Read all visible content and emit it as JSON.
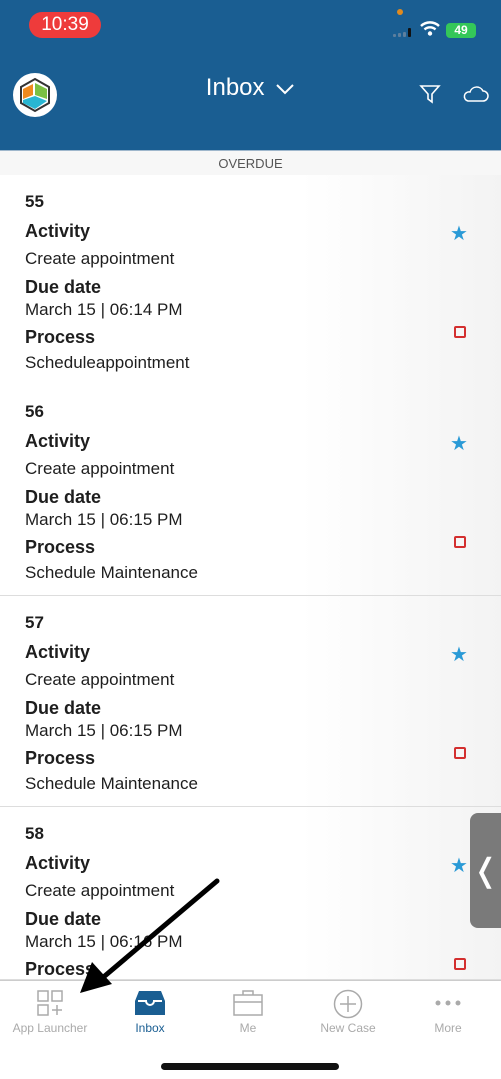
{
  "status_bar": {
    "time": "10:39",
    "battery": "49"
  },
  "header": {
    "title": "Inbox",
    "filter_icon": "filter-icon",
    "cloud_icon": "cloud-icon",
    "colors": {
      "header": "#1a5e92"
    }
  },
  "section": {
    "label": "OVERDUE"
  },
  "labels": {
    "activity": "Activity",
    "due_date": "Due date",
    "process": "Process"
  },
  "items": [
    {
      "number": "55",
      "activity": "Create appointment",
      "due_date": "March 15 | 06:14 PM",
      "process": "Scheduleappointment"
    },
    {
      "number": "56",
      "activity": "Create appointment",
      "due_date": "March 15 | 06:15 PM",
      "process": "Schedule Maintenance"
    },
    {
      "number": "57",
      "activity": "Create appointment",
      "due_date": "March 15 | 06:15 PM",
      "process": "Schedule Maintenance"
    },
    {
      "number": "58",
      "activity": "Create appointment",
      "due_date": "March 15 | 06:16 PM",
      "process": ""
    }
  ],
  "tabs": [
    {
      "label": "App Launcher",
      "icon": "app-launcher-icon"
    },
    {
      "label": "Inbox",
      "icon": "inbox-icon",
      "active": true
    },
    {
      "label": "Me",
      "icon": "briefcase-icon"
    },
    {
      "label": "New Case",
      "icon": "plus-circle-icon"
    },
    {
      "label": "More",
      "icon": "more-icon"
    }
  ]
}
